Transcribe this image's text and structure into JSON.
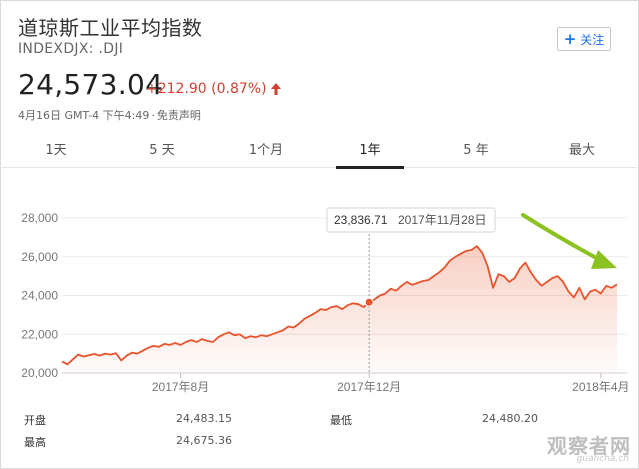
{
  "header": {
    "title": "道琼斯工业平均指数",
    "ticker": "INDEXDJX: .DJI",
    "follow_label": "关注"
  },
  "quote": {
    "price": "24,573.04",
    "change": "+212.90 (0.87%)",
    "date": "4月16日 GMT-4 下午4:49",
    "disclaimer": "免责声明",
    "change_color": "#d23f31"
  },
  "tabs": [
    {
      "label": "1天"
    },
    {
      "label": "5 天"
    },
    {
      "label": "1个月"
    },
    {
      "label": "1年",
      "active": true
    },
    {
      "label": "5 年"
    },
    {
      "label": "最大"
    }
  ],
  "tooltip": {
    "value": "23,836.71",
    "date": "2017年11月28日"
  },
  "stats": {
    "open_label": "开盘",
    "open_value": "24,483.15",
    "high_label": "最高",
    "high_value": "24,675.36",
    "low_label": "最低",
    "low_value": "24,480.20"
  },
  "watermark": {
    "main": "观察者网",
    "sub": "guancha.cn"
  },
  "chart_data": {
    "type": "area",
    "title": "",
    "xlabel": "",
    "ylabel": "",
    "ylim": [
      20000,
      28000
    ],
    "y_ticks": [
      "28,000",
      "26,000",
      "24,000",
      "22,000",
      "20,000"
    ],
    "x_ticks": [
      "2017年8月",
      "2017年12月",
      "2018年4月"
    ],
    "line_color": "#e8542c",
    "arrow_color": "#8cc21f",
    "grid": true,
    "series": [
      {
        "values": [
          20600,
          20450,
          20700,
          20950,
          20850,
          20920,
          20980,
          20900,
          21000,
          20950,
          21020,
          20650,
          20900,
          21050,
          21000,
          21150,
          21300,
          21400,
          21350,
          21500,
          21450,
          21550,
          21450,
          21600,
          21700,
          21600,
          21750,
          21650,
          21600,
          21850,
          22000,
          22100,
          21950,
          22000,
          21800,
          21900,
          21850,
          21950,
          21900,
          22000,
          22100,
          22200,
          22400,
          22350,
          22550,
          22800,
          22950,
          23100,
          23300,
          23250,
          23400,
          23450,
          23300,
          23500,
          23600,
          23550,
          23400,
          23650,
          23800,
          24000,
          24100,
          24350,
          24250,
          24500,
          24700,
          24550,
          24650,
          24750,
          24800,
          25000,
          25200,
          25450,
          25800,
          26000,
          26150,
          26300,
          26350,
          26550,
          26200,
          25500,
          24400,
          25100,
          25000,
          24700,
          24900,
          25400,
          25700,
          25200,
          24800,
          24500,
          24700,
          24900,
          25000,
          24700,
          24200,
          23900,
          24400,
          23800,
          24200,
          24300,
          24100,
          24500,
          24400,
          24573
        ]
      }
    ],
    "highlight": {
      "index": 57,
      "value": 23836.71
    }
  }
}
